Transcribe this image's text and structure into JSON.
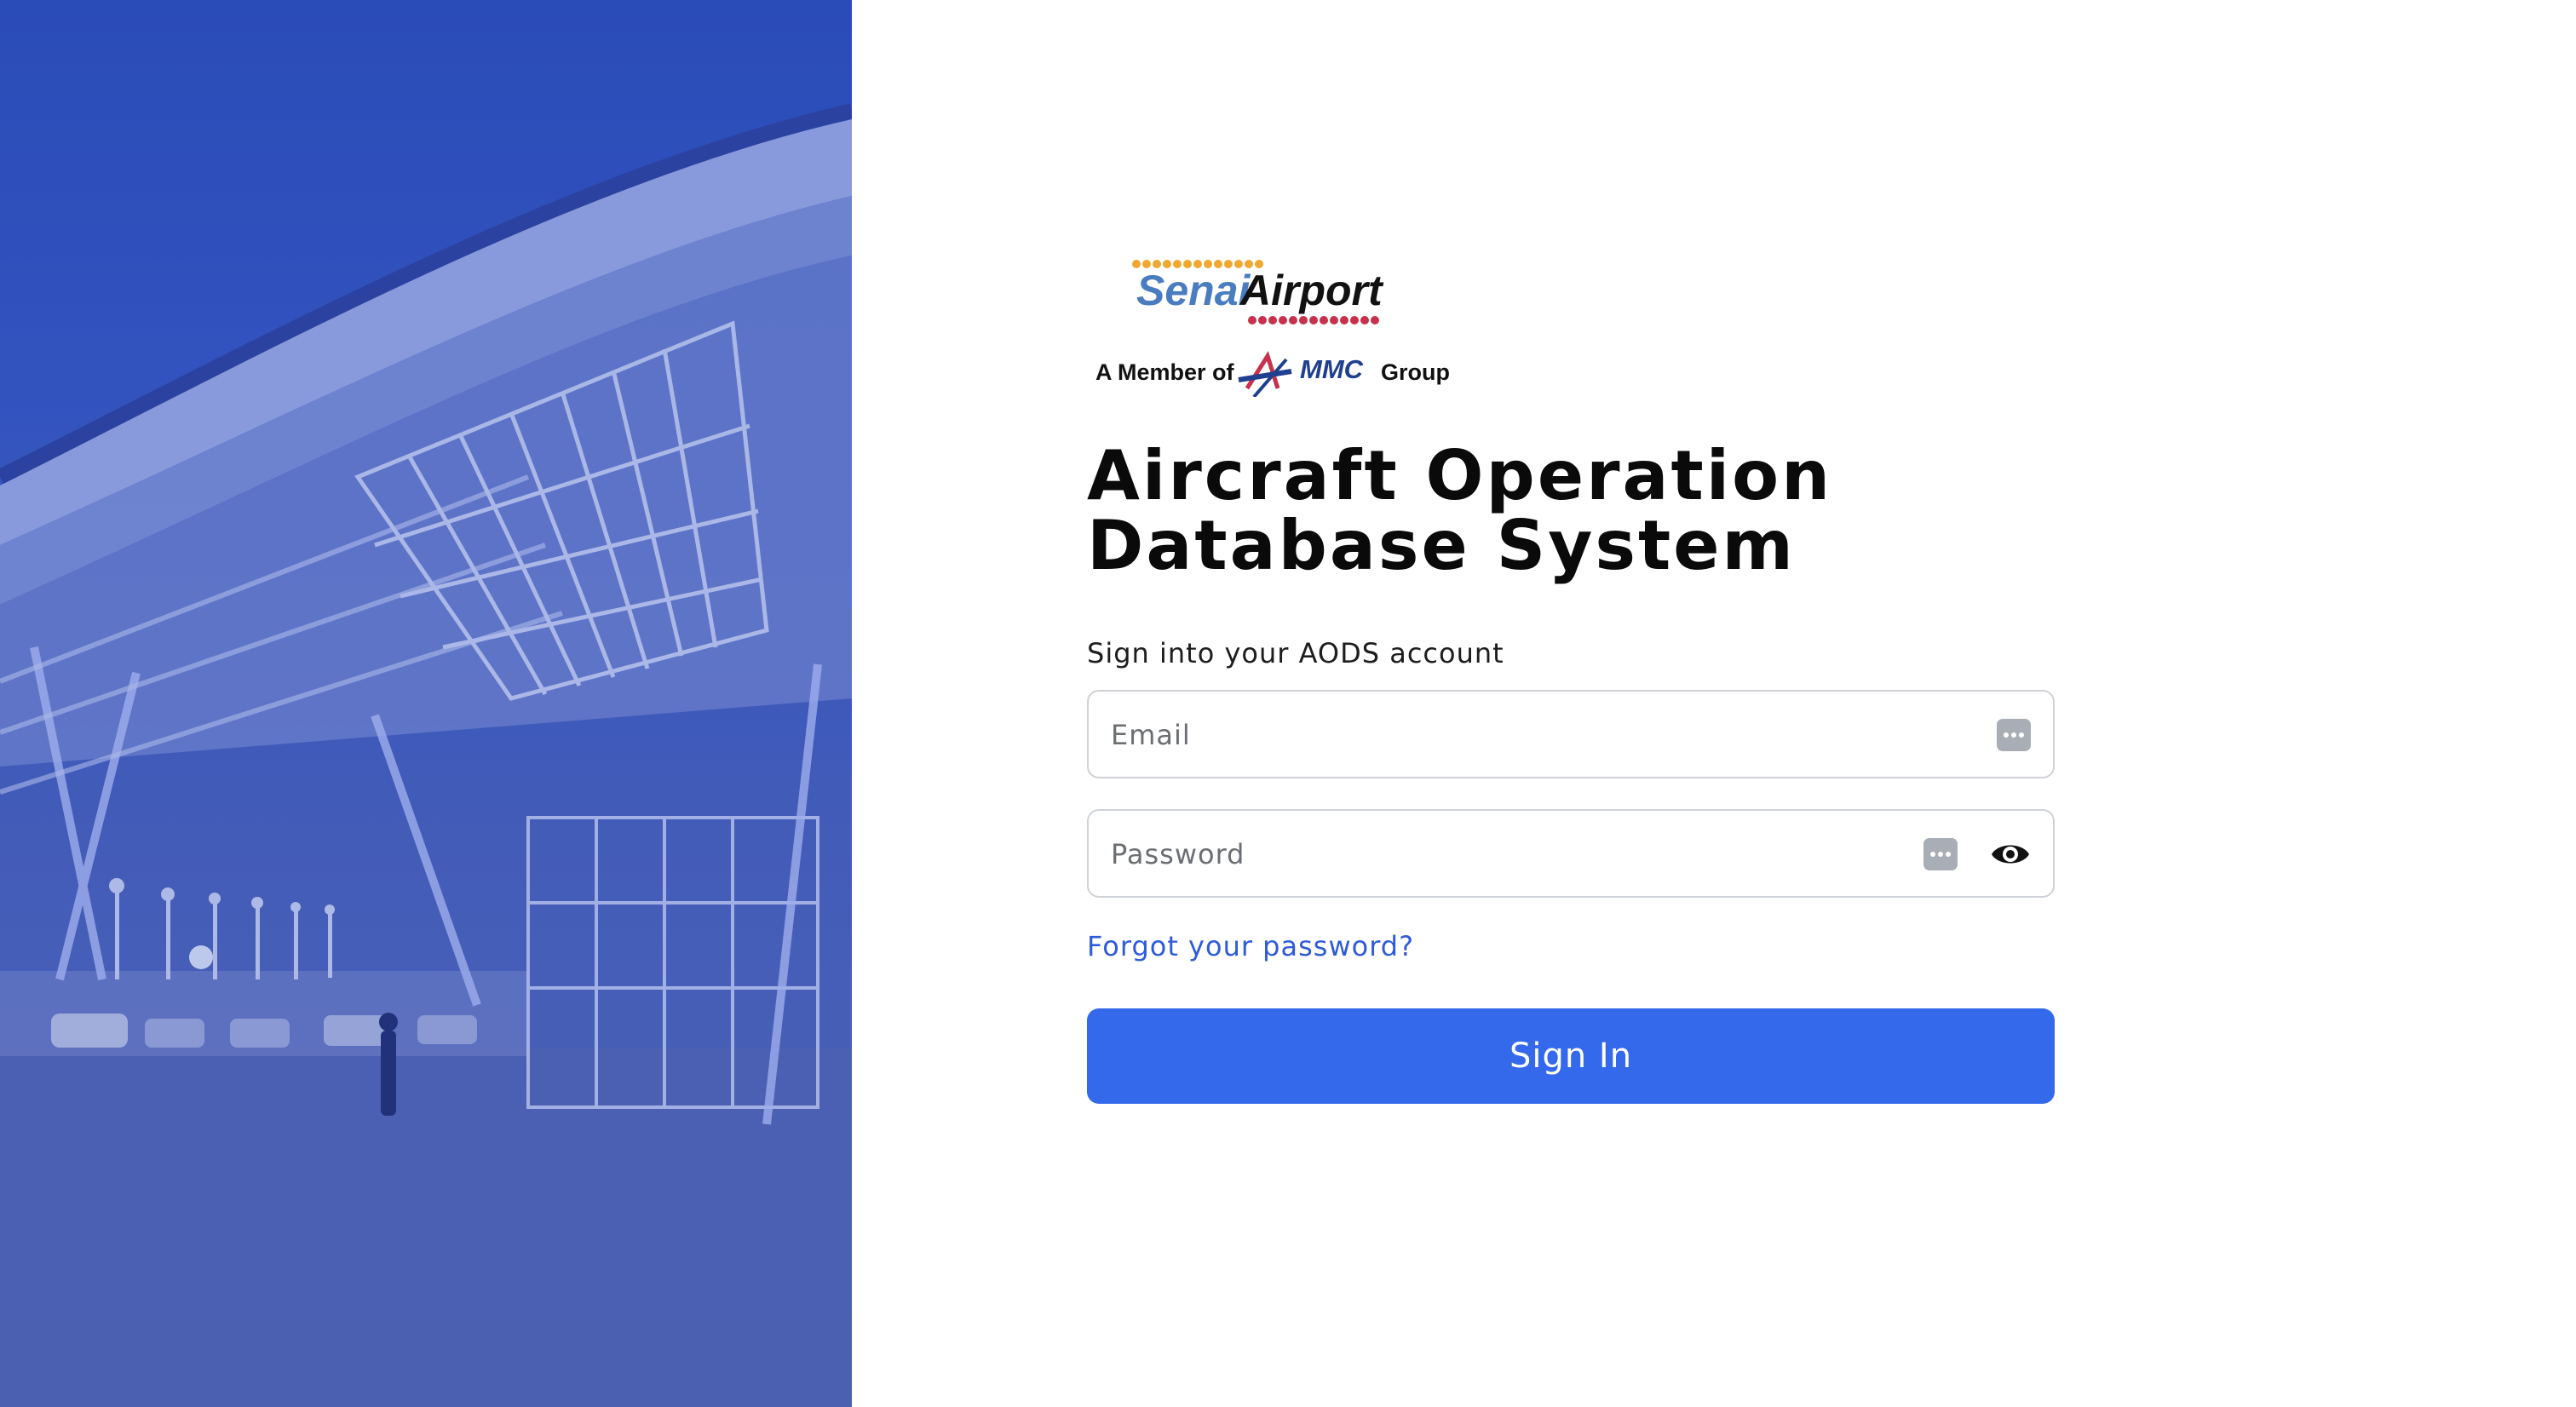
{
  "brand": {
    "logo_primary": "SenaiAirport",
    "logo_secondary": "A Member of MMC Group",
    "colors": {
      "logo_blue": "#4a7cc0",
      "logo_orange": "#f0a830",
      "logo_red": "#c8314b",
      "mmc_blue": "#1f3f8f"
    }
  },
  "title": {
    "line1": "Aircraft Operation",
    "line2": "Database System"
  },
  "form": {
    "subtitle": "Sign into your AODS account",
    "email": {
      "placeholder": "Email",
      "value": "",
      "autofill_icon": "password-manager-icon"
    },
    "password": {
      "placeholder": "Password",
      "value": "",
      "autofill_icon": "password-manager-icon",
      "toggle_icon": "eye-icon"
    },
    "forgot_password": "Forgot your password?",
    "submit_label": "Sign In"
  },
  "colors": {
    "primary": "#3369ea",
    "link": "#2e5bd8",
    "text": "#0a0a0a",
    "border": "#cfd2d8",
    "hero_overlay": "#2a4db8"
  }
}
